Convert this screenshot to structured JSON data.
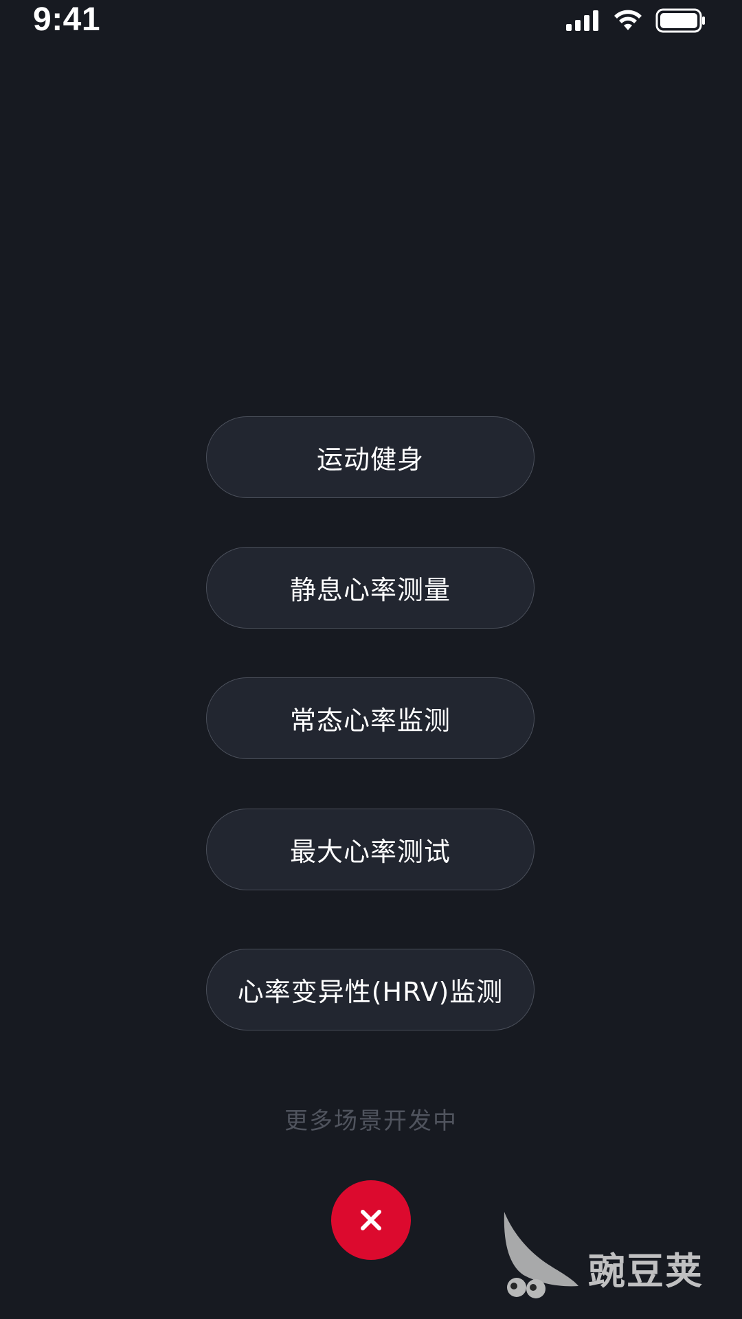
{
  "status_bar": {
    "time": "9:41",
    "icons": [
      "signal-icon",
      "wifi-icon",
      "battery-icon"
    ]
  },
  "menu": {
    "items": [
      {
        "label": "运动健身"
      },
      {
        "label": "静息心率测量"
      },
      {
        "label": "常态心率监测"
      },
      {
        "label": "最大心率测试"
      },
      {
        "label": "心率变异性(HRV)监测"
      }
    ]
  },
  "footnote": "更多场景开发中",
  "close_button": {
    "icon": "close-icon",
    "color": "#dc0a2e"
  },
  "watermark": {
    "text": "豌豆荚",
    "icon": "pea-pod-logo-icon"
  },
  "colors": {
    "background": "#171a21",
    "button_fill": "#222630",
    "button_border": "#4a4f5a",
    "muted_text": "#50545e"
  }
}
